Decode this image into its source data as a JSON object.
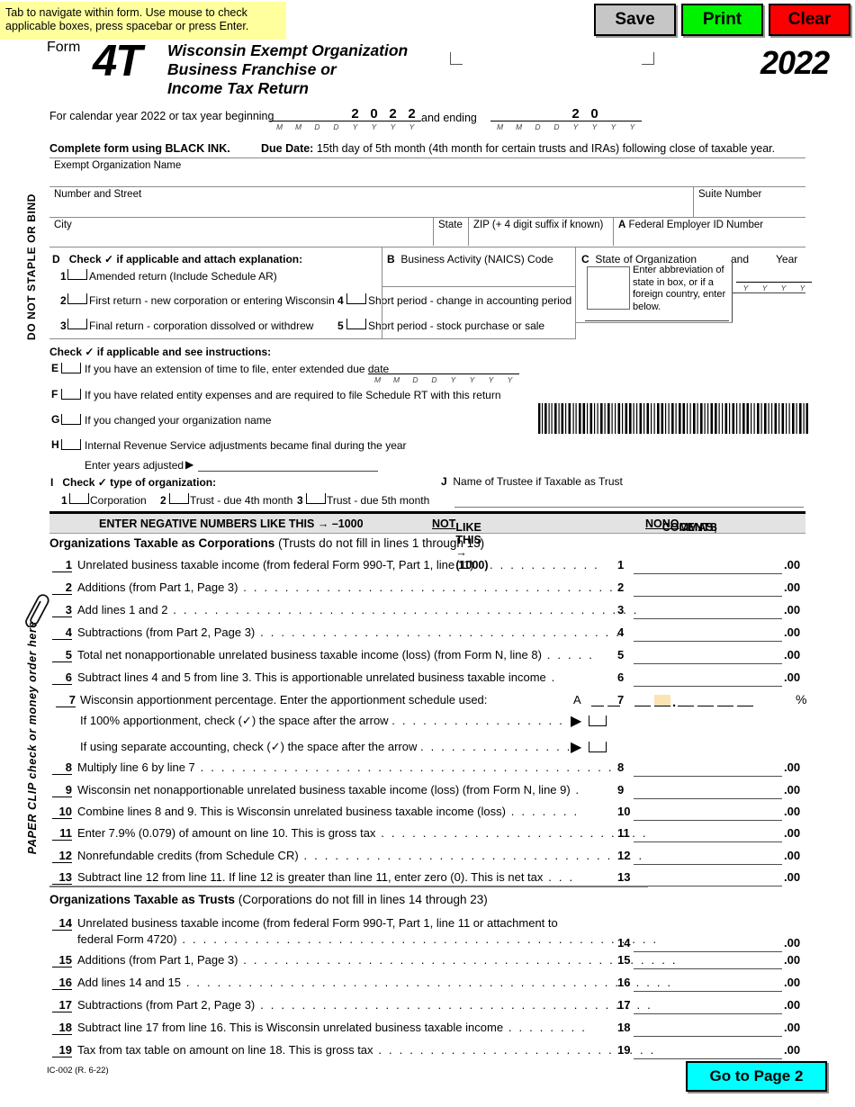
{
  "tip": "Tab to navigate within form. Use mouse to check applicable boxes, press spacebar or press Enter.",
  "toolbar": {
    "save_label": "Save",
    "print_label": "Print",
    "clear_label": "Clear",
    "save_color": "#c6c6c6",
    "print_color": "#00f200",
    "clear_color": "#fb0000"
  },
  "masthead": {
    "form_word": "Form",
    "form_number": "4T",
    "title_line1": "Wisconsin Exempt Organization",
    "title_line2": "Business Franchise or",
    "title_line3": "Income Tax Return",
    "year": "2022"
  },
  "calendar": {
    "prefix": "For calendar year 2022 or tax year beginning",
    "ending_word": "and ending",
    "begin_digits": [
      "",
      "",
      "",
      "",
      "2",
      "0",
      "2",
      "2"
    ],
    "end_digits": [
      "",
      "",
      "",
      "",
      "2",
      "0",
      "",
      ""
    ],
    "labels": [
      "M",
      "M",
      "D",
      "D",
      "Y",
      "Y",
      "Y",
      "Y"
    ]
  },
  "instructions": {
    "black_ink": "Complete form using BLACK INK.",
    "due_date_label": "Due Date:",
    "due_date_text": "15th day of 5th month (4th month for certain trusts and IRAs) following close of taxable year."
  },
  "side_text": {
    "staple": "DO NOT STAPLE OR BIND",
    "paperclip": "PAPER CLIP check or money order here"
  },
  "address": {
    "org_name_label": "Exempt Organization Name",
    "org_name_value": "",
    "street_label": "Number and Street",
    "street_value": "",
    "suite_label": "Suite Number",
    "suite_value": "",
    "city_label": "City",
    "city_value": "",
    "state_label": "State",
    "state_value": "",
    "zip_label": "ZIP (+ 4 digit suffix if known)",
    "zip_value": "",
    "fein_label": "A  Federal Employer ID Number",
    "fein_letter": "A",
    "fein_text": "Federal Employer ID Number",
    "fein_value": ""
  },
  "sectionD": {
    "heading": "D   Check ✓ if applicable and attach explanation:",
    "letter": "D",
    "heading_text": "Check ✓ if applicable and attach explanation:",
    "items": [
      {
        "num": "1",
        "label": "Amended return (Include Schedule AR)"
      },
      {
        "num": "2",
        "label": "First return - new corporation or entering Wisconsin"
      },
      {
        "num": "3",
        "label": "Final return - corporation dissolved or withdrew"
      },
      {
        "num": "4",
        "label": "Short period - change in accounting period"
      },
      {
        "num": "5",
        "label": "Short period - stock purchase or sale"
      }
    ]
  },
  "sectionB": {
    "letter": "B",
    "label": "Business Activity (NAICS) Code",
    "value": ""
  },
  "sectionC": {
    "letter": "C",
    "label": "State of Organization",
    "and_word": "and",
    "year_word": "Year",
    "hint": "Enter abbreviation of state in box, or if a foreign country, enter below.",
    "state_value": "",
    "year_digits": [
      "",
      "",
      "",
      ""
    ],
    "year_labels": [
      "Y",
      "Y",
      "Y",
      "Y"
    ],
    "foreign_value": ""
  },
  "checks": {
    "heading": "Check ✓ if applicable and see instructions:",
    "items": [
      {
        "letter": "E",
        "label": "If you have an extension of time to file, enter extended due date"
      },
      {
        "letter": "F",
        "label": "If you have related entity expenses and are required to file Schedule RT with this return"
      },
      {
        "letter": "G",
        "label": "If you changed your organization name"
      },
      {
        "letter": "H",
        "label": "Internal Revenue Service adjustments became final during the year"
      }
    ],
    "ext_date_labels": [
      "M",
      "M",
      "D",
      "D",
      "Y",
      "Y",
      "Y",
      "Y"
    ],
    "years_adjusted_label": "Enter years adjusted",
    "years_adjusted_value": ""
  },
  "sectionI": {
    "letter": "I",
    "heading": "Check ✓ type of organization:",
    "options": [
      {
        "num": "1",
        "label": "Corporation"
      },
      {
        "num": "2",
        "label": "Trust - due 4th month"
      },
      {
        "num": "3",
        "label": "Trust - due 5th month"
      }
    ]
  },
  "sectionJ": {
    "letter": "J",
    "label": "Name of Trustee if Taxable as Trust",
    "value": ""
  },
  "negbar": {
    "left": "ENTER NEGATIVE NUMBERS LIKE THIS → –1000",
    "mid_underline": "NOT",
    "mid_rest": " LIKE THIS → (1000)",
    "right_u1": "NO",
    "right_m": " COMMAS; ",
    "right_u2": "NO",
    "right_end": " CENTS"
  },
  "corp_section": {
    "bold": "Organizations Taxable as Corporations",
    "normal": " (Trusts do not fill in lines 1 through 13)"
  },
  "trust_section": {
    "bold": "Organizations Taxable as Trusts",
    "normal": " (Corporations do not fill in lines 14 through 23)"
  },
  "lines": [
    {
      "num": "1",
      "text": "Unrelated business taxable income (from federal Form 990-T, Part 1, line 11)",
      "dots": ". . . . . . . . . . . .",
      "value": "",
      "cents": ".00"
    },
    {
      "num": "2",
      "text": "Additions (from Part 1, Page 3)",
      "dots": ". . . . . . . . . . . . . . . . . . . . . . . . . . . . . . . . . . . . .",
      "value": "",
      "cents": ".00"
    },
    {
      "num": "3",
      "text": "Add lines 1 and 2",
      "dots": ". . . . . . . . . . . . . . . . . . . . . . . . . . . . . . . . . . . . . . . . . . . . .",
      "value": "",
      "cents": ".00"
    },
    {
      "num": "4",
      "text": "Subtractions (from Part 2, Page 3)",
      "dots": ". . . . . . . . . . . . . . . . . . . . . . . . . . . . . . . . . . .",
      "value": "",
      "cents": ".00"
    },
    {
      "num": "5",
      "text": "Total net nonapportionable unrelated business taxable income (loss) (from Form N, line 8)",
      "dots": ". . . . .",
      "value": "",
      "cents": ".00"
    },
    {
      "num": "6",
      "text": "Subtract lines 4 and 5 from line 3. This is apportionable unrelated business taxable income",
      "dots": " .",
      "value": "",
      "cents": ".00"
    },
    {
      "num": "8",
      "text": "Multiply line 6 by line 7",
      "dots": ". . . . . . . . . . . . . . . . . . . . . . . . . . . . . . . . . . . . . . . . .",
      "value": "",
      "cents": ".00"
    },
    {
      "num": "9",
      "text": "Wisconsin net nonapportionable unrelated business taxable income (loss) (from Form N, line 9)",
      "dots": " .",
      "value": "",
      "cents": ".00"
    },
    {
      "num": "10",
      "text": "Combine lines 8 and 9. This is Wisconsin unrelated business taxable income (loss)",
      "dots": ". . . . . . .",
      "value": "",
      "cents": ".00"
    },
    {
      "num": "11",
      "text": "Enter 7.9% (0.079) of amount on line 10. This is gross tax",
      "dots": ". . . . . . . . . . . . . . . . . . . . . . . . . .",
      "value": "",
      "cents": ".00"
    },
    {
      "num": "12",
      "text": "Nonrefundable credits (from Schedule CR)",
      "dots": ". . . . . . . . . . . . . . . . . . . . . . . . . . . . . . . . .",
      "value": "",
      "cents": ".00"
    },
    {
      "num": "13",
      "text": "Subtract line 12 from line 11. If line 12 is greater than line 11, enter zero (0). This is net tax",
      "dots": ". . .",
      "value": "",
      "cents": ".00"
    },
    {
      "num": "14",
      "text": "Unrelated business taxable income (from federal Form 990-T, Part 1, line 11 or attachment to",
      "text2": "federal Form 4720)",
      "dots": ". . . . . . . . . . . . . . . . . . . . . . . . . . . . . . . . . . . . . . . . . . . . . .",
      "value": "",
      "cents": ".00"
    },
    {
      "num": "15",
      "text": "Additions (from Part 1, Page 3)",
      "dots": ". . . . . . . . . . . . . . . . . . . . . . . . . . . . . . . . . . . . . . . . . .",
      "value": "",
      "cents": ".00"
    },
    {
      "num": "16",
      "text": "Add lines 14 and 15",
      "dots": ". . . . . . . . . . . . . . . . . . . . . . . . . . . . . . . . . . . . . . . . . . . . . . .",
      "value": "",
      "cents": ".00"
    },
    {
      "num": "17",
      "text": "Subtractions (from Part 2, Page 3)",
      "dots": ". . . . . . . . . . . . . . . . . . . . . . . . . . . . . . . . . . . . . .",
      "value": "",
      "cents": ".00"
    },
    {
      "num": "18",
      "text": "Subtract line 17 from line 16. This is Wisconsin unrelated business taxable income",
      "dots": ". . . . . . . .",
      "value": "",
      "cents": ".00"
    },
    {
      "num": "19",
      "text": "Tax from tax table on amount on line 18. This is gross tax",
      "dots": ". . . . . . . . . . . . . . . . . . . . . . . . . . .",
      "value": "",
      "cents": ".00"
    }
  ],
  "line7": {
    "num": "7",
    "text": "Wisconsin apportionment percentage. Enter the apportionment schedule used:",
    "schedule_letter": "A",
    "schedule_value": "",
    "pct_symbol": "%",
    "highlight_color": "#fce3b2",
    "sub1": "If 100% apportionment, check (✓) the space after the arrow",
    "sub1_dots": ". . . . . . . . . . . . . . . . . .",
    "sub2": "If using separate accounting, check (✓) the space after the arrow",
    "sub2_dots": ". . . . . . . . . . . . . . ."
  },
  "footer": {
    "code": "IC-002 (R. 6-22)",
    "goto_label": "Go to Page 2",
    "goto_color": "#00ffff"
  }
}
